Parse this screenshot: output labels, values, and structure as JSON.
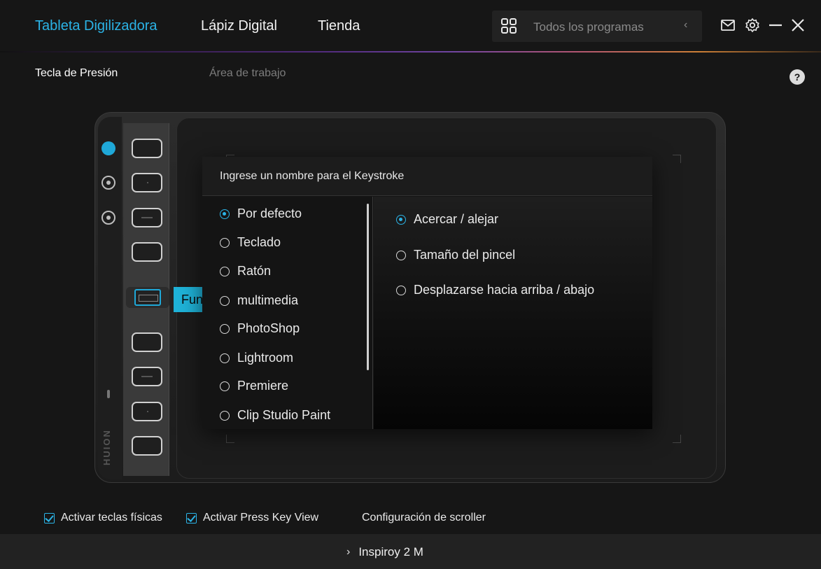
{
  "nav": {
    "tabs": [
      {
        "label": "Tableta Digilizadora",
        "active": true
      },
      {
        "label": "Lápiz Digital",
        "active": false
      },
      {
        "label": "Tienda",
        "active": false
      }
    ],
    "programs_label": "Todos los programas",
    "icons": [
      "grid-icon",
      "chevron-left-icon",
      "mail-icon",
      "gear-icon",
      "minimize-icon",
      "close-icon"
    ]
  },
  "subtabs": [
    {
      "label": "Tecla de Presión",
      "active": true
    },
    {
      "label": "Área de trabajo",
      "active": false
    }
  ],
  "help_label": "?",
  "tablet": {
    "function_label": "Función",
    "brand": "HUION",
    "accent": "#1fa8d8"
  },
  "dialog": {
    "title": "Ingrese un nombre para el Keystroke",
    "categories": [
      {
        "label": "Por defecto",
        "checked": true
      },
      {
        "label": "Teclado",
        "checked": false
      },
      {
        "label": "Ratón",
        "checked": false
      },
      {
        "label": "multimedia",
        "checked": false
      },
      {
        "label": "PhotoShop",
        "checked": false
      },
      {
        "label": "Lightroom",
        "checked": false
      },
      {
        "label": "Premiere",
        "checked": false
      },
      {
        "label": "Clip Studio Paint",
        "checked": false
      }
    ],
    "options": [
      {
        "label": "Acercar / alejar",
        "checked": true
      },
      {
        "label": "Tamaño del pincel",
        "checked": false
      },
      {
        "label": "Desplazarse hacia arriba / abajo",
        "checked": false
      }
    ]
  },
  "bottom": {
    "activate_keys": "Activar teclas físicas",
    "activate_view": "Activar Press Key View",
    "scroller_config": "Configuración de scroller",
    "device": "Inspiroy 2 M"
  },
  "colors": {
    "accent": "#2bb3e6",
    "background": "#161616"
  }
}
